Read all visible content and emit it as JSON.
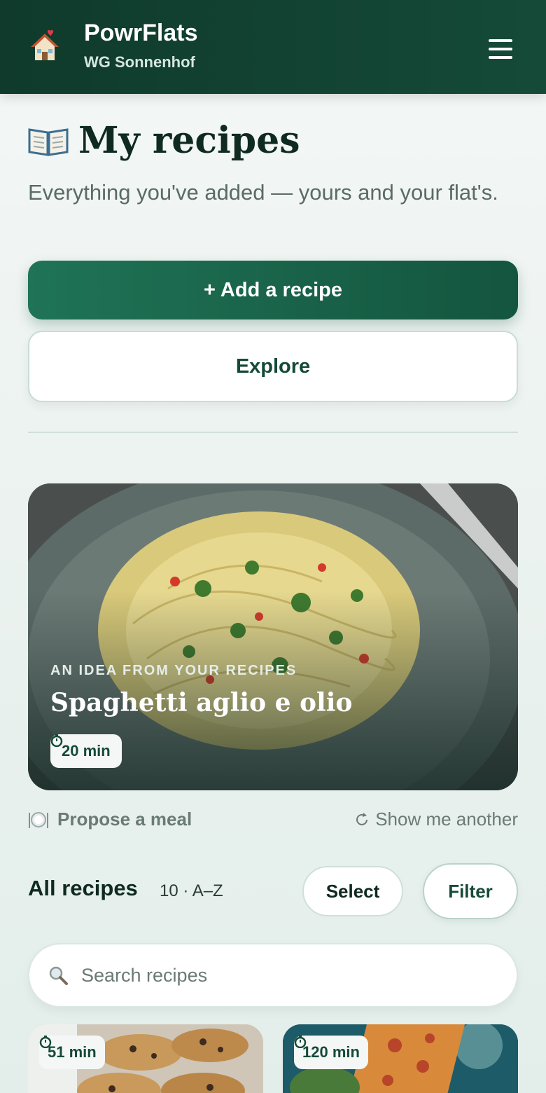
{
  "header": {
    "brand": "PowrFlats",
    "flat_name": "WG Sonnenhof",
    "logo_icon": "house-with-heart-icon",
    "menu_icon": "hamburger-menu-icon"
  },
  "page": {
    "title": "My recipes",
    "title_icon": "open-book-icon",
    "subtitle": "Everything you've added — yours and your flat's."
  },
  "actions": {
    "add_label": "+ Add a recipe",
    "explore_label": "Explore"
  },
  "hero": {
    "kicker": "AN IDEA FROM YOUR RECIPES",
    "title": "Spaghetti aglio e olio",
    "time": "20 min"
  },
  "suggest": {
    "propose_label": "Propose a meal",
    "another_label": "Show me another"
  },
  "list": {
    "title": "All recipes",
    "meta": "10 · A–Z",
    "select_label": "Select",
    "filter_label": "Filter",
    "search_placeholder": "Search recipes"
  },
  "cards": [
    {
      "time": "51 min"
    },
    {
      "time": "120 min"
    }
  ],
  "colors": {
    "header": "#154a38",
    "accent": "#1f7356",
    "text": "#0f2a20"
  }
}
